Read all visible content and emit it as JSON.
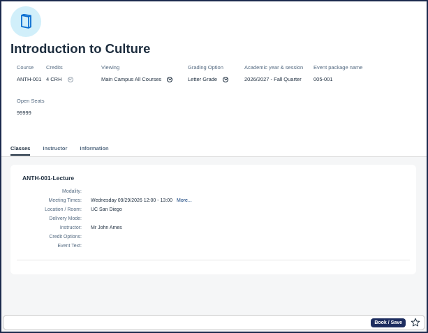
{
  "course_title": "Introduction to Culture",
  "attributes": {
    "course": {
      "label": "Course",
      "value": "ANTH-001"
    },
    "credits": {
      "label": "Credits",
      "value": "4 CRH"
    },
    "viewing": {
      "label": "Viewing",
      "value": "Main Campus All Courses"
    },
    "grading": {
      "label": "Grading Option",
      "value": "Letter Grade"
    },
    "session": {
      "label": "Academic year & session",
      "value": "2026/2027 - Fall Quarter"
    },
    "package": {
      "label": "Event package name",
      "value": "005-001"
    },
    "seats": {
      "label": "Open Seats",
      "value": "99999"
    }
  },
  "tabs": [
    {
      "label": "Classes",
      "active": true
    },
    {
      "label": "Instructor",
      "active": false
    },
    {
      "label": "Information",
      "active": false
    }
  ],
  "class_card": {
    "title": "ANTH-001-Lecture",
    "rows": [
      {
        "key": "Modality:",
        "value": ""
      },
      {
        "key": "Meeting Times:",
        "value": "Wednesday 09/29/2026  12:00 - 13:00",
        "more": "More..."
      },
      {
        "key": "Location / Room:",
        "value": "UC San Diego"
      },
      {
        "key": "Delivery Mode:",
        "value": ""
      },
      {
        "key": "Instructor:",
        "value": "Mr John Ames"
      },
      {
        "key": "Credit Options:",
        "value": ""
      },
      {
        "key": "Event Text:",
        "value": ""
      }
    ]
  },
  "footer": {
    "book_label": "Book / Save"
  },
  "icons": {
    "avatar": "book-icon",
    "favorite": "star-icon"
  },
  "colors": {
    "accent": "#1d2d5f",
    "avatar_bg": "#d1effa",
    "icon": "#0a6ed1"
  }
}
